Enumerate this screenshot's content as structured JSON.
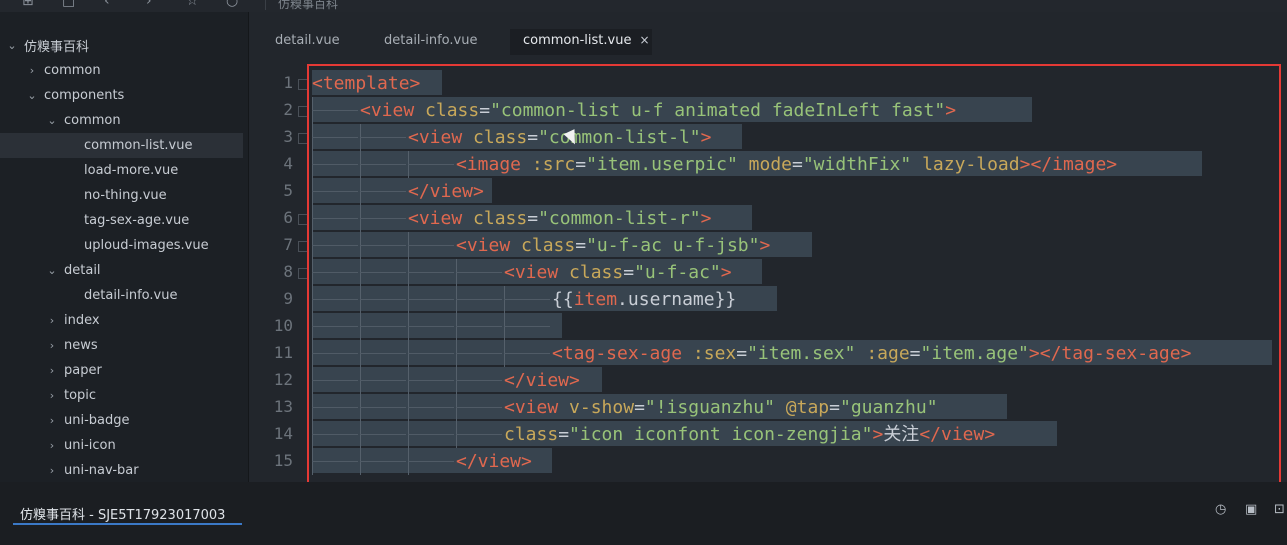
{
  "topbar": {
    "path_text": "仿糗事百科"
  },
  "sidebar": {
    "items": [
      {
        "label": "仿糗事百科",
        "chevron": "down",
        "indent": 6
      },
      {
        "label": "common",
        "chevron": "right",
        "indent": 26
      },
      {
        "label": "components",
        "chevron": "down",
        "indent": 26
      },
      {
        "label": "common",
        "chevron": "down",
        "indent": 46
      },
      {
        "label": "common-list.vue",
        "chevron": "",
        "indent": 84,
        "selected": true
      },
      {
        "label": "load-more.vue",
        "chevron": "",
        "indent": 84
      },
      {
        "label": "no-thing.vue",
        "chevron": "",
        "indent": 84
      },
      {
        "label": "tag-sex-age.vue",
        "chevron": "",
        "indent": 84
      },
      {
        "label": "uploud-images.vue",
        "chevron": "",
        "indent": 84
      },
      {
        "label": "detail",
        "chevron": "down",
        "indent": 46
      },
      {
        "label": "detail-info.vue",
        "chevron": "",
        "indent": 84
      },
      {
        "label": "index",
        "chevron": "right",
        "indent": 46
      },
      {
        "label": "news",
        "chevron": "right",
        "indent": 46
      },
      {
        "label": "paper",
        "chevron": "right",
        "indent": 46
      },
      {
        "label": "topic",
        "chevron": "right",
        "indent": 46
      },
      {
        "label": "uni-badge",
        "chevron": "right",
        "indent": 46
      },
      {
        "label": "uni-icon",
        "chevron": "right",
        "indent": 46
      },
      {
        "label": "uni-nav-bar",
        "chevron": "right",
        "indent": 46
      }
    ]
  },
  "tabs": [
    {
      "label": "detail.vue",
      "active": false
    },
    {
      "label": "detail-info.vue",
      "active": false
    },
    {
      "label": "common-list.vue",
      "active": true,
      "close": "×"
    }
  ],
  "code": {
    "lines": [
      {
        "num": "1",
        "indent": 0,
        "fold": true,
        "tokens": [
          [
            "tag",
            "<template>"
          ]
        ]
      },
      {
        "num": "2",
        "indent": 1,
        "fold": true,
        "tokens": [
          [
            "tag",
            "<view"
          ],
          [
            "txt",
            " "
          ],
          [
            "attr",
            "class"
          ],
          [
            "pun",
            "="
          ],
          [
            "str",
            "\"common-list u-f animated fadeInLeft fast\""
          ],
          [
            "tag",
            ">"
          ]
        ]
      },
      {
        "num": "3",
        "indent": 2,
        "fold": true,
        "tokens": [
          [
            "tag",
            "<view"
          ],
          [
            "txt",
            " "
          ],
          [
            "attr",
            "class"
          ],
          [
            "pun",
            "="
          ],
          [
            "str",
            "\"common-list-l\""
          ],
          [
            "tag",
            ">"
          ]
        ]
      },
      {
        "num": "4",
        "indent": 3,
        "fold": false,
        "tokens": [
          [
            "tag",
            "<image"
          ],
          [
            "txt",
            " "
          ],
          [
            "attr",
            ":src"
          ],
          [
            "pun",
            "="
          ],
          [
            "str",
            "\"item.userpic\""
          ],
          [
            "txt",
            " "
          ],
          [
            "attr",
            "mode"
          ],
          [
            "pun",
            "="
          ],
          [
            "str",
            "\"widthFix\""
          ],
          [
            "txt",
            " "
          ],
          [
            "attr",
            "lazy-load"
          ],
          [
            "tag",
            "></image>"
          ]
        ]
      },
      {
        "num": "5",
        "indent": 2,
        "fold": false,
        "tokens": [
          [
            "tag",
            "</view>"
          ]
        ]
      },
      {
        "num": "6",
        "indent": 2,
        "fold": true,
        "tokens": [
          [
            "tag",
            "<view"
          ],
          [
            "txt",
            " "
          ],
          [
            "attr",
            "class"
          ],
          [
            "pun",
            "="
          ],
          [
            "str",
            "\"common-list-r\""
          ],
          [
            "tag",
            ">"
          ]
        ]
      },
      {
        "num": "7",
        "indent": 3,
        "fold": true,
        "tokens": [
          [
            "tag",
            "<view"
          ],
          [
            "txt",
            " "
          ],
          [
            "attr",
            "class"
          ],
          [
            "pun",
            "="
          ],
          [
            "str",
            "\"u-f-ac u-f-jsb\""
          ],
          [
            "tag",
            ">"
          ]
        ]
      },
      {
        "num": "8",
        "indent": 4,
        "fold": true,
        "tokens": [
          [
            "tag",
            "<view"
          ],
          [
            "txt",
            " "
          ],
          [
            "attr",
            "class"
          ],
          [
            "pun",
            "="
          ],
          [
            "str",
            "\"u-f-ac\""
          ],
          [
            "tag",
            ">"
          ]
        ]
      },
      {
        "num": "9",
        "indent": 5,
        "fold": false,
        "tokens": [
          [
            "pun",
            "{{"
          ],
          [
            "mus",
            "item"
          ],
          [
            "pun",
            "."
          ],
          [
            "txt",
            "username"
          ],
          [
            "pun",
            "}}"
          ],
          [
            "txt",
            " "
          ]
        ]
      },
      {
        "num": "10",
        "indent": 5,
        "fold": false,
        "tokens": [
          [
            "txt",
            "  "
          ]
        ]
      },
      {
        "num": "11",
        "indent": 5,
        "fold": false,
        "tokens": [
          [
            "tag",
            "<tag-sex-age"
          ],
          [
            "txt",
            " "
          ],
          [
            "attr",
            ":sex"
          ],
          [
            "pun",
            "="
          ],
          [
            "str",
            "\"item.sex\""
          ],
          [
            "txt",
            " "
          ],
          [
            "attr",
            ":age"
          ],
          [
            "pun",
            "="
          ],
          [
            "str",
            "\"item.age\""
          ],
          [
            "tag",
            "></tag-sex-age>"
          ]
        ]
      },
      {
        "num": "12",
        "indent": 4,
        "fold": false,
        "tokens": [
          [
            "tag",
            "</view>"
          ]
        ]
      },
      {
        "num": "13",
        "indent": 4,
        "fold": false,
        "tokens": [
          [
            "tag",
            "<view"
          ],
          [
            "txt",
            " "
          ],
          [
            "attr",
            "v-show"
          ],
          [
            "pun",
            "="
          ],
          [
            "str",
            "\"!isguanzhu\""
          ],
          [
            "txt",
            " "
          ],
          [
            "attr",
            "@tap"
          ],
          [
            "pun",
            "="
          ],
          [
            "str",
            "\"guanzhu\""
          ],
          [
            "txt",
            " "
          ]
        ]
      },
      {
        "num": "14",
        "indent": 4,
        "fold": false,
        "tokens": [
          [
            "attr",
            "class"
          ],
          [
            "pun",
            "="
          ],
          [
            "str",
            "\"icon iconfont icon-zengjia\""
          ],
          [
            "tag",
            ">"
          ],
          [
            "txt",
            "关注"
          ],
          [
            "tag",
            "</view>"
          ]
        ]
      },
      {
        "num": "15",
        "indent": 3,
        "fold": false,
        "tokens": [
          [
            "tag",
            "</view>"
          ]
        ]
      }
    ]
  },
  "statusbar": {
    "tab_label": "仿糗事百科 - SJE5T17923017003"
  },
  "colors": {
    "highlight_border": "#e53935",
    "selection": "#38444f"
  }
}
